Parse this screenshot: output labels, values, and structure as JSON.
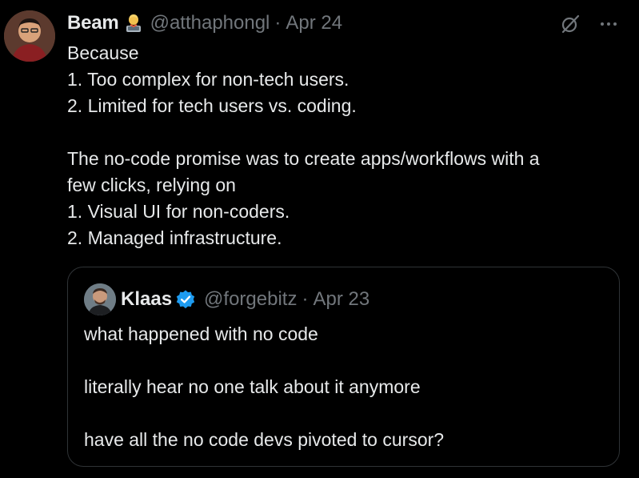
{
  "tweet": {
    "author_name": "Beam",
    "author_emoji": "technologist-emoji",
    "handle": "@atthaphongl",
    "separator": "·",
    "date": "Apr 24",
    "body": {
      "line1": "Because",
      "line2": "1. Too complex for non-tech users.",
      "line3": "2. Limited for tech users vs. coding.",
      "line4": "The no-code promise was to create apps/workflows with a",
      "line5": "few clicks, relying on",
      "line6": "1. Visual UI for non-coders.",
      "line7": "2. Managed infrastructure."
    },
    "icons": {
      "grok": "grok-icon",
      "more": "more-options-icon"
    }
  },
  "quote": {
    "author_name": "Klaas",
    "verified": "verified-badge-icon",
    "handle": "@forgebitz",
    "separator": "·",
    "date": "Apr 23",
    "body": {
      "line1": "what happened with no code",
      "line2": "literally hear no one talk about it anymore",
      "line3": "have all the no code devs pivoted to cursor?"
    }
  },
  "colors": {
    "background": "#000000",
    "text_primary": "#e7e9ea",
    "text_secondary": "#71767b",
    "border": "#2f3336",
    "verified_blue": "#1d9bf0"
  }
}
